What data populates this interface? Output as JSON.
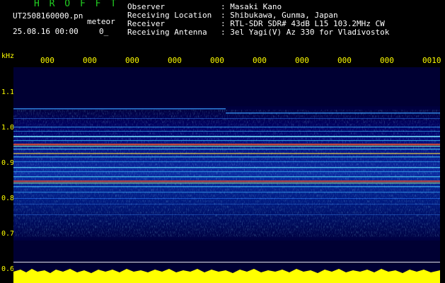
{
  "header": {
    "app_title": "H R O F F T",
    "file_name": "UT2508160000.pn",
    "meteor_label": "meteor",
    "date_time": "25.08.16 00:00",
    "counter": "0_"
  },
  "station_info": [
    {
      "label": "Observer",
      "sep": ":",
      "value": "Masaki Kano"
    },
    {
      "label": "Receiving Location",
      "sep": ":",
      "value": "Shibukawa, Gunma, Japan"
    },
    {
      "label": "Receiver",
      "sep": ":",
      "value": "RTL-SDR SDR# 43dB L15 103.2MHz CW"
    },
    {
      "label": "Receiving Antenna",
      "sep": ":",
      "value": "3el Yagi(V) Az 330 for Vladivostok"
    }
  ],
  "frequency_axis": {
    "unit": "kHz",
    "ticks": [
      "1.1",
      "1.0",
      "0.9",
      "0.8",
      "0.7",
      "0.6"
    ]
  },
  "time_axis": {
    "ticks": [
      "000",
      "000",
      "000",
      "000",
      "000",
      "000",
      "000",
      "000",
      "000",
      "0010"
    ]
  },
  "colors": {
    "background": "#000000",
    "plot_background": "#000033",
    "title_green": "#22d022",
    "axis_yellow": "#ffff00",
    "text_white": "#ffffff"
  }
}
